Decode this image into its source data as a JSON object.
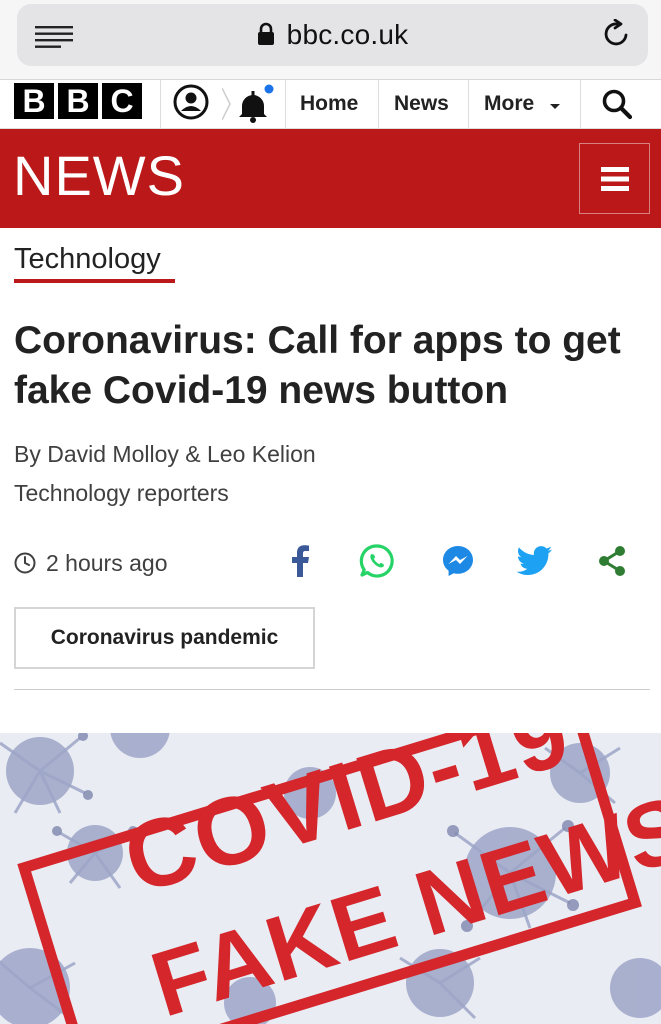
{
  "browser": {
    "url": "bbc.co.uk",
    "reader_icon": "reader-mode-icon",
    "lock_icon": "lock-icon",
    "reload_icon": "reload-icon"
  },
  "masthead": {
    "logo_letters": [
      "B",
      "B",
      "C"
    ],
    "account_icon": "account-icon",
    "notifications_icon": "bell-icon",
    "nav": [
      {
        "label": "Home"
      },
      {
        "label": "News"
      },
      {
        "label": "More"
      }
    ],
    "search_icon": "search-icon"
  },
  "banner": {
    "title": "NEWS",
    "menu_icon": "hamburger-menu-icon",
    "color": "#bb1919"
  },
  "article": {
    "section": "Technology",
    "headline": "Coronavirus: Call for apps to get fake Covid-19 news button",
    "byline": "By David Molloy & Leo Kelion",
    "byline_role": "Technology reporters",
    "timestamp": "2 hours ago",
    "share_icons": [
      "facebook-icon",
      "whatsapp-icon",
      "messenger-icon",
      "twitter-icon",
      "share-icon"
    ],
    "tag": "Coronavirus pandemic",
    "hero_image": {
      "line1": "COVID-19",
      "line2": "FAKE NEWS",
      "stamp_color": "#d4262b"
    }
  }
}
